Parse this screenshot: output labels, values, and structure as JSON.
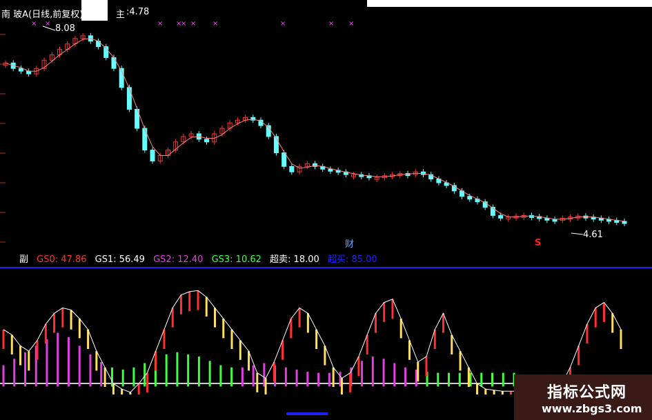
{
  "header": {
    "stock_label": "南 玻A(日线,前复权)",
    "main_label": "主",
    "main_value": ":4.78"
  },
  "price_labels": {
    "high": "8.08",
    "low": "4.61",
    "cai": "财",
    "s_mark": "S"
  },
  "indicator": {
    "title": "副",
    "items": [
      {
        "label": "GS0: 47.86",
        "color": "#ff3030"
      },
      {
        "label": "GS1: 56.49",
        "color": "#ffffff"
      },
      {
        "label": "GS2: 12.40",
        "color": "#e040e0"
      },
      {
        "label": "GS3: 10.62",
        "color": "#40ff40"
      },
      {
        "label": "超卖: 18.00",
        "color": "#ffffff"
      },
      {
        "label": "超买: 85.00",
        "color": "#2020ff"
      }
    ]
  },
  "watermark": {
    "line1": "指标公式网",
    "line2": "www.zbgs3.com"
  },
  "colors": {
    "up": "#ff3030",
    "down": "#66ffff",
    "ma": "#ff8080"
  },
  "chart_data": {
    "type": "candlestick",
    "markers_x_count": 8,
    "price_series": [
      7.55,
      7.45,
      7.4,
      7.35,
      7.45,
      7.6,
      7.7,
      7.8,
      7.9,
      8.0,
      8.05,
      7.95,
      7.85,
      7.65,
      7.45,
      7.1,
      6.7,
      6.35,
      5.95,
      5.75,
      5.85,
      5.95,
      6.1,
      6.2,
      6.25,
      6.15,
      6.1,
      6.25,
      6.35,
      6.45,
      6.5,
      6.55,
      6.5,
      6.4,
      6.2,
      5.9,
      5.65,
      5.55,
      5.65,
      5.7,
      5.65,
      5.6,
      5.58,
      5.55,
      5.5,
      5.5,
      5.48,
      5.45,
      5.45,
      5.48,
      5.5,
      5.52,
      5.5,
      5.55,
      5.5,
      5.42,
      5.35,
      5.3,
      5.2,
      5.1,
      5.05,
      5.0,
      4.9,
      4.75,
      4.7,
      4.72,
      4.74,
      4.75,
      4.73,
      4.7,
      4.68,
      4.66,
      4.7,
      4.72,
      4.74,
      4.72,
      4.7,
      4.68,
      4.66,
      4.64,
      4.63
    ],
    "gs1_series": [
      60,
      55,
      45,
      40,
      50,
      65,
      75,
      80,
      78,
      70,
      60,
      40,
      25,
      10,
      5,
      2,
      10,
      20,
      40,
      60,
      80,
      92,
      95,
      96,
      90,
      80,
      70,
      60,
      50,
      40,
      20,
      15,
      30,
      50,
      70,
      80,
      75,
      60,
      45,
      25,
      15,
      20,
      35,
      55,
      75,
      85,
      88,
      70,
      50,
      30,
      35,
      60,
      75,
      55,
      40,
      25,
      10,
      5,
      4,
      3,
      3,
      3,
      2,
      2,
      2,
      2,
      10,
      25,
      45,
      65,
      80,
      85,
      75,
      60
    ],
    "gs2_series": [
      12,
      18,
      24,
      30,
      36,
      42,
      38,
      30,
      22,
      15,
      10,
      8,
      10,
      14,
      18,
      22,
      24,
      22,
      20,
      16,
      12,
      10,
      10,
      12,
      14,
      12,
      10,
      8,
      6,
      5,
      5,
      6,
      10,
      16,
      20,
      18,
      14,
      10,
      8,
      6,
      5,
      5,
      5,
      5,
      5,
      5,
      5,
      5
    ],
    "oversold": 18,
    "overbought": 85
  }
}
